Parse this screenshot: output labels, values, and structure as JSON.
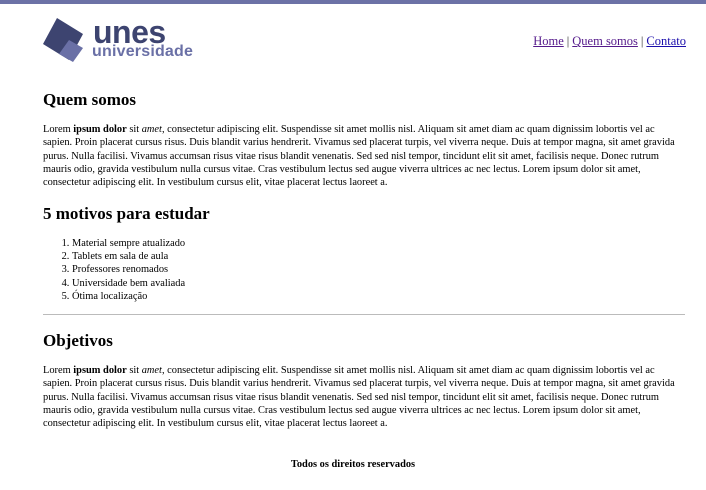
{
  "brand": {
    "name": "unes",
    "subtitle": "universidade",
    "colors": {
      "dark": "#3d4470",
      "light": "#6a70a6",
      "accent_bar": "#6c72a6"
    }
  },
  "nav": {
    "home": "Home",
    "about": "Quem somos",
    "contact": "Contato",
    "separator": "|"
  },
  "about": {
    "title": "Quem somos",
    "lead_plain": "Lorem ",
    "lead_bold": "ipsum dolor",
    "lead_mid": " sit ",
    "lead_italic": "amet",
    "text": ", consectetur adipiscing elit. Suspendisse sit amet mollis nisl. Aliquam sit amet diam ac quam dignissim lobortis vel ac sapien. Proin placerat cursus risus. Duis blandit varius hendrerit. Vivamus sed placerat turpis, vel viverra neque. Duis at tempor magna, sit amet gravida purus. Nulla facilisi. Vivamus accumsan risus vitae risus blandit venenatis. Sed sed nisl tempor, tincidunt elit sit amet, facilisis neque. Donec rutrum mauris odio, gravida vestibulum nulla cursus vitae. Cras vestibulum lectus sed augue viverra ultrices ac nec lectus. Lorem ipsum dolor sit amet, consectetur adipiscing elit. In vestibulum cursus elit, vitae placerat lectus laoreet a."
  },
  "reasons": {
    "title": "5 motivos para estudar",
    "items": [
      "Material sempre atualizado",
      "Tablets em sala de aula",
      "Professores renomados",
      "Universidade bem avaliada",
      "Ótima localização"
    ]
  },
  "goals": {
    "title": "Objetivos",
    "lead_plain": "Lorem ",
    "lead_bold": "ipsum dolor",
    "lead_mid": " sit ",
    "lead_italic": "amet",
    "text": ", consectetur adipiscing elit. Suspendisse sit amet mollis nisl. Aliquam sit amet diam ac quam dignissim lobortis vel ac sapien. Proin placerat cursus risus. Duis blandit varius hendrerit. Vivamus sed placerat turpis, vel viverra neque. Duis at tempor magna, sit amet gravida purus. Nulla facilisi. Vivamus accumsan risus vitae risus blandit venenatis. Sed sed nisl tempor, tincidunt elit sit amet, facilisis neque. Donec rutrum mauris odio, gravida vestibulum nulla cursus vitae. Cras vestibulum lectus sed augue viverra ultrices ac nec lectus. Lorem ipsum dolor sit amet, consectetur adipiscing elit. In vestibulum cursus elit, vitae placerat lectus laoreet a."
  },
  "footer": {
    "text": "Todos os direitos reservados"
  }
}
